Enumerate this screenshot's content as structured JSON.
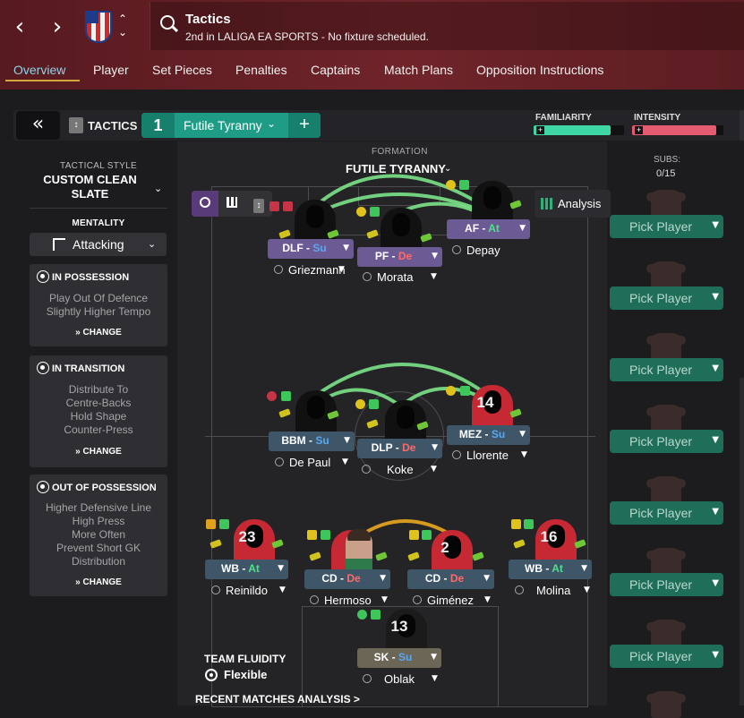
{
  "header": {
    "title": "Tactics",
    "subtitle": "2nd in LALIGA EA SPORTS - No fixture scheduled."
  },
  "tabs": [
    {
      "label": "Overview",
      "active": true
    },
    {
      "label": "Player"
    },
    {
      "label": "Set Pieces"
    },
    {
      "label": "Penalties"
    },
    {
      "label": "Captains"
    },
    {
      "label": "Match Plans"
    },
    {
      "label": "Opposition Instructions"
    }
  ],
  "toolbar": {
    "back_icon": "double-chevron-left-icon",
    "tactics_label": "TACTICS",
    "tactic_number": "1",
    "tactic_name": "Futile Tyranny",
    "add_label": "+",
    "familiarity_label": "FAMILIARITY",
    "familiarity_level": 0.85,
    "intensity_label": "INTENSITY",
    "intensity_level": 0.92,
    "colors": {
      "familiarity": "#3fd6a6",
      "intensity": "#e55b6f"
    }
  },
  "left": {
    "tactical_style_label": "TACTICAL STYLE",
    "tactical_style": "CUSTOM CLEAN SLATE",
    "mentality_label": "MENTALITY",
    "mentality": "Attacking",
    "in_possession": {
      "title": "IN POSSESSION",
      "lines": [
        "Play Out Of Defence",
        "Slightly Higher Tempo"
      ],
      "change": "CHANGE"
    },
    "in_transition": {
      "title": "IN TRANSITION",
      "lines": [
        "Distribute To",
        "Centre-Backs",
        "Hold Shape",
        "Counter-Press"
      ],
      "change": "CHANGE"
    },
    "out_of_possession": {
      "title": "OUT OF POSSESSION",
      "lines": [
        "Higher Defensive Line",
        "High Press",
        "More Often",
        "Prevent Short GK",
        "Distribution"
      ],
      "change": "CHANGE"
    }
  },
  "formation": {
    "label": "FORMATION",
    "name": "FUTILE TYRANNY",
    "analysis_label": "Analysis",
    "team_fluidity_label": "TEAM FLUIDITY",
    "team_fluidity": "Flexible",
    "recent_matches": "RECENT MATCHES ANALYSIS >"
  },
  "players": [
    {
      "role": "DLF",
      "duty": "Su",
      "name": "Griezmann",
      "number": ""
    },
    {
      "role": "PF",
      "duty": "De",
      "name": "Morata",
      "number": ""
    },
    {
      "role": "AF",
      "duty": "At",
      "name": "Depay",
      "number": ""
    },
    {
      "role": "BBM",
      "duty": "Su",
      "name": "De Paul",
      "number": ""
    },
    {
      "role": "DLP",
      "duty": "De",
      "name": "Koke",
      "number": ""
    },
    {
      "role": "MEZ",
      "duty": "Su",
      "name": "Llorente",
      "number": "14"
    },
    {
      "role": "WB",
      "duty": "At",
      "name": "Reinildo",
      "number": "23"
    },
    {
      "role": "CD",
      "duty": "De",
      "name": "Hermoso",
      "number": ""
    },
    {
      "role": "CD",
      "duty": "De",
      "name": "Giménez",
      "number": "2"
    },
    {
      "role": "WB",
      "duty": "At",
      "name": "Molina",
      "number": "16"
    },
    {
      "role": "SK",
      "duty": "Su",
      "name": "Oblak",
      "number": "13"
    }
  ],
  "duty_colors": {
    "Su": "#5aa7f0",
    "De": "#ff6a6a",
    "At": "#4fe08a"
  },
  "subs": {
    "label": "SUBS:",
    "count": "0/15",
    "pick_label": "Pick Player",
    "slots": 7
  }
}
